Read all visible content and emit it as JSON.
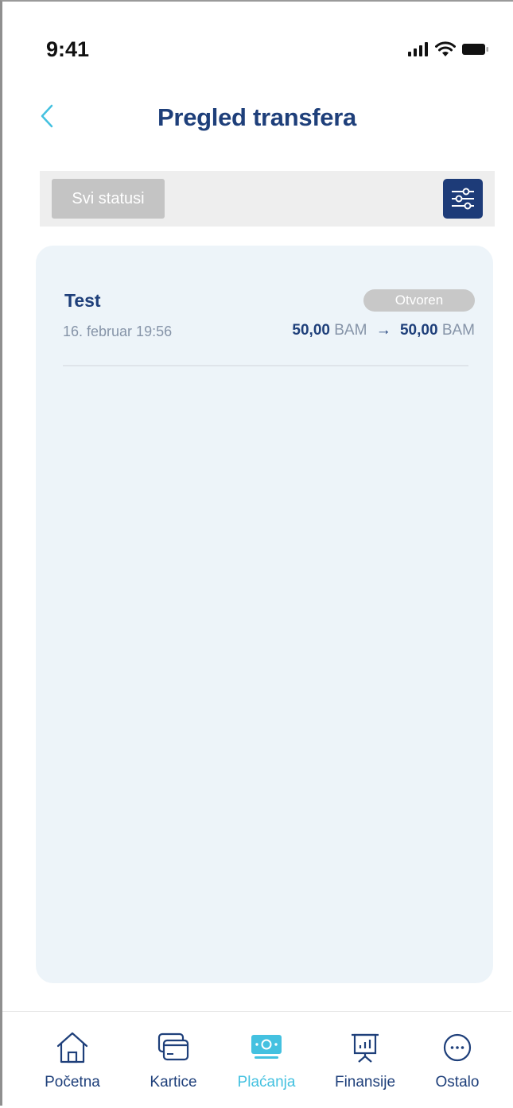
{
  "status_bar": {
    "time": "9:41"
  },
  "header": {
    "title": "Pregled transfera"
  },
  "filter": {
    "status_label": "Svi statusi"
  },
  "transaction": {
    "name": "Test",
    "status": "Otvoren",
    "date": "16. februar 19:56",
    "from_amount": "50,00",
    "from_currency": "BAM",
    "arrow": "→",
    "to_amount": "50,00",
    "to_currency": "BAM"
  },
  "tabs": [
    {
      "label": "Početna",
      "icon": "home-icon"
    },
    {
      "label": "Kartice",
      "icon": "cards-icon"
    },
    {
      "label": "Plaćanja",
      "icon": "payments-icon",
      "active": true
    },
    {
      "label": "Finansije",
      "icon": "finance-chart-icon"
    },
    {
      "label": "Ostalo",
      "icon": "more-dots-icon"
    }
  ],
  "colors": {
    "primary": "#1e3f7a",
    "accent": "#44c1e0",
    "panel": "#edf4f9",
    "badge": "#c8c8c8"
  }
}
